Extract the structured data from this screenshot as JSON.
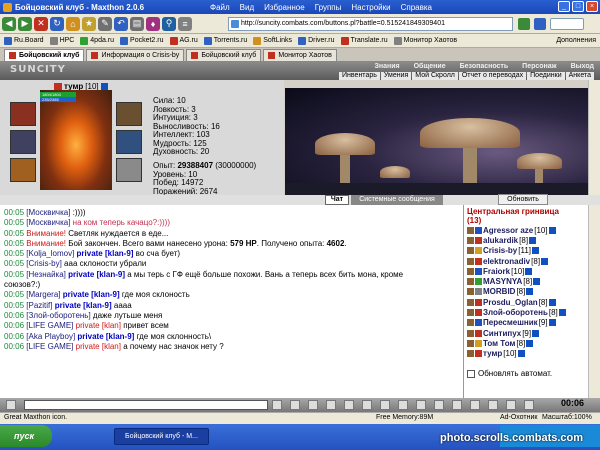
{
  "window": {
    "title": "Бойцовский клуб - Maxthon 2.0.6"
  },
  "menu": [
    "Файл",
    "Вид",
    "Избранное",
    "Группы",
    "Настройки",
    "Справка"
  ],
  "address": {
    "url": "http://suncity.combats.com/buttons.pl?battle=0.515241849309401"
  },
  "bookmarks": [
    "Ru.Board",
    "НРС",
    "4pda.ru",
    "Pocket2.ru",
    "AG.ru",
    "Torrents.ru",
    "SoftLinks",
    "Driver.ru",
    "Translate.ru",
    "Монитор Хаотов"
  ],
  "bookmarks_extra": "Дополнения",
  "tabs": [
    "Бойцовский клуб",
    "Информация о Crisis-by",
    "Бойцовский клуб",
    "Монитор Хаотов"
  ],
  "game": {
    "logo": "SUNCITY",
    "menu_top": [
      "Знания",
      "Общение",
      "Безопасность",
      "Персонаж",
      "Выход"
    ],
    "menu_bottom": [
      "Инвентарь",
      "Умения",
      "Мой Скролл",
      "Отчет о переводах",
      "Поединки",
      "Анкета"
    ]
  },
  "character": {
    "name": "тумр",
    "level": "[10]",
    "hp": "1804/1804",
    "mp": "235/2385",
    "stats": [
      "Сила: 10",
      "Ловкость: 3",
      "Интуиция: 3",
      "Выносливость: 16",
      "Интеллект: 103",
      "Мудрость: 125",
      "Духовность: 20"
    ],
    "exp_label": "Опыт:",
    "exp": "29388407",
    "exp_next": "(30000000)",
    "level_line": "Уровень: 10",
    "wins": "Побед: 14972",
    "losses": "Поражений: 2674"
  },
  "chat_tabs": {
    "chat": "Чат",
    "system": "Системные сообщения",
    "refresh": "Обновить"
  },
  "chat": [
    {
      "time": "00:05",
      "parts": [
        {
          "t": "[Москвичка]",
          "c": "nick"
        },
        {
          "t": " :))))",
          "c": ""
        }
      ]
    },
    {
      "time": "00:05",
      "parts": [
        {
          "t": "[Москвичка]",
          "c": "nick"
        },
        {
          "t": " на ком теперь качацо?:))))",
          "c": "muted"
        }
      ]
    },
    {
      "time": "00:05",
      "parts": [
        {
          "t": "Внимание!",
          "c": "red"
        },
        {
          "t": " Светляк нуждается в еде...",
          "c": ""
        }
      ]
    },
    {
      "time": "00:05",
      "parts": [
        {
          "t": "Внимание!",
          "c": "red"
        },
        {
          "t": " Бой закончен. Всего вами нанесено урона: ",
          "c": ""
        },
        {
          "t": "579 HP",
          "c": "bold"
        },
        {
          "t": ". Получено опыта: ",
          "c": ""
        },
        {
          "t": "4602",
          "c": "bold"
        },
        {
          "t": ".",
          "c": ""
        }
      ]
    },
    {
      "time": "00:05",
      "parts": [
        {
          "t": "[Kolja_lomov]",
          "c": "nick"
        },
        {
          "t": " private [klan-9]",
          "c": "blue"
        },
        {
          "t": " во сча бует)",
          "c": ""
        }
      ]
    },
    {
      "time": "00:05",
      "parts": [
        {
          "t": "[Crisis-by]",
          "c": "nick"
        },
        {
          "t": " ааа склоности убрали",
          "c": ""
        }
      ]
    },
    {
      "time": "00:05",
      "parts": [
        {
          "t": "[Незнайка]",
          "c": "nick"
        },
        {
          "t": " private [klan-9]",
          "c": "blue"
        },
        {
          "t": " а мы терь с ГФ ещё больше похожи. Вань а теперь всех бить мона, кроме",
          "c": ""
        }
      ]
    },
    {
      "time": "",
      "parts": [
        {
          "t": "союзов?:)",
          "c": ""
        }
      ]
    },
    {
      "time": "00:05",
      "parts": [
        {
          "t": "[Margera]",
          "c": "nick"
        },
        {
          "t": " private [klan-9]",
          "c": "blue"
        },
        {
          "t": " где моя склоность",
          "c": ""
        }
      ]
    },
    {
      "time": "00:05",
      "parts": [
        {
          "t": "[Pazitif]",
          "c": "nick"
        },
        {
          "t": " private [klan-9]",
          "c": "blue"
        },
        {
          "t": " аааа",
          "c": ""
        }
      ]
    },
    {
      "time": "00:06",
      "parts": [
        {
          "t": "[Злой-оборотень]",
          "c": "nick"
        },
        {
          "t": " даже лутьше меня",
          "c": ""
        }
      ]
    },
    {
      "time": "00:06",
      "parts": [
        {
          "t": "[LIFE GAME]",
          "c": "nick"
        },
        {
          "t": " private [klan]",
          "c": "red"
        },
        {
          "t": " привет всем",
          "c": ""
        }
      ]
    },
    {
      "time": "00:06",
      "parts": [
        {
          "t": "[Aka Playboy]",
          "c": "nick"
        },
        {
          "t": " private [klan-9]",
          "c": "blue"
        },
        {
          "t": " где моя склонность\\",
          "c": ""
        }
      ]
    },
    {
      "time": "00:06",
      "parts": [
        {
          "t": "[LIFE GAME]",
          "c": "nick"
        },
        {
          "t": " private [klan]",
          "c": "red"
        },
        {
          "t": " а почему нас значок нету ?",
          "c": ""
        }
      ]
    }
  ],
  "online": {
    "title": "Центральная гринвица",
    "count": "(13)",
    "users": [
      {
        "name": "Agressor aze",
        "level": "[10]",
        "color": "#2050c0"
      },
      {
        "name": "alukardik",
        "level": "[8]",
        "color": "#c03020"
      },
      {
        "name": "Crisis-by",
        "level": "[11]",
        "color": "#d0a020"
      },
      {
        "name": "elektronadiv",
        "level": "[8]",
        "color": "#c03020"
      },
      {
        "name": "Fraiork",
        "level": "[10]",
        "color": "#2050c0"
      },
      {
        "name": "MASYNYA",
        "level": "[8]",
        "color": "#30a030"
      },
      {
        "name": "MORBID",
        "level": "[8]",
        "color": "#808080"
      },
      {
        "name": "Prosdu_Oglan",
        "level": "[8]",
        "color": "#c03020"
      },
      {
        "name": "Злой-оборотень",
        "level": "[8]",
        "color": "#c03020"
      },
      {
        "name": "Пересмешник",
        "level": "[9]",
        "color": "#2050c0"
      },
      {
        "name": "Синтипух",
        "level": "[9]",
        "color": "#c03020"
      },
      {
        "name": "Том Том",
        "level": "[8]",
        "color": "#d0a020"
      },
      {
        "name": "тумр",
        "level": "[10]",
        "color": "#c03020"
      }
    ],
    "auto_update": "Обновлять автомат."
  },
  "clock": "00:06",
  "status": {
    "left": "Great Maxthon icon.",
    "memory": "Free Memory:89M",
    "adblock": "Ad-Охотник",
    "zoom": "Масштаб:100%"
  },
  "taskbar": {
    "start": "пуск",
    "task": "Бойцовский клуб - M..."
  },
  "watermark": "photo.scrolls.combats.com"
}
